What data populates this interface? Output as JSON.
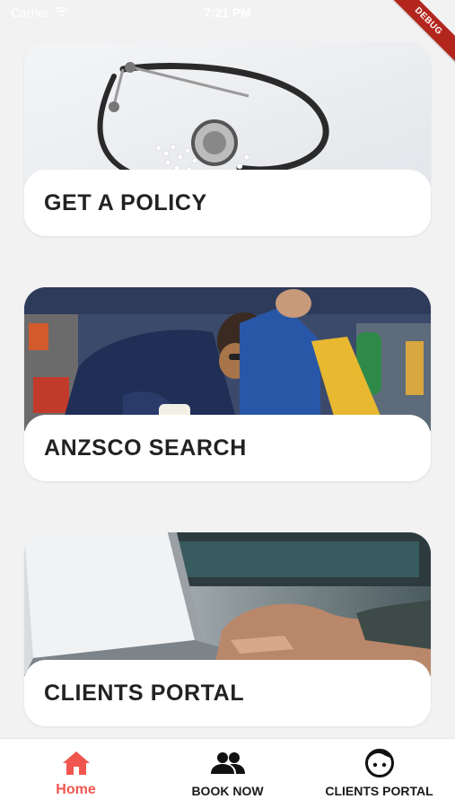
{
  "status_bar": {
    "carrier": "Carrier",
    "time": "7:21 PM"
  },
  "debug_banner": "DEBUG",
  "cards": [
    {
      "label": "GET A POLICY",
      "image": "stethoscope-photo"
    },
    {
      "label": "ANZSCO SEARCH",
      "image": "workshop-students-photo"
    },
    {
      "label": "CLIENTS PORTAL",
      "image": "laptop-typing-photo"
    }
  ],
  "bottom_nav": {
    "items": [
      {
        "label": "Home",
        "icon": "home-icon",
        "active": true
      },
      {
        "label": "BOOK NOW",
        "icon": "people-icon",
        "active": false
      },
      {
        "label": "CLIENTS PORTAL",
        "icon": "face-icon",
        "active": false
      }
    ]
  },
  "colors": {
    "accent": "#f0564e",
    "background": "#f2f2f2",
    "card": "#ffffff",
    "text": "#222222",
    "debug": "#b3261e"
  }
}
